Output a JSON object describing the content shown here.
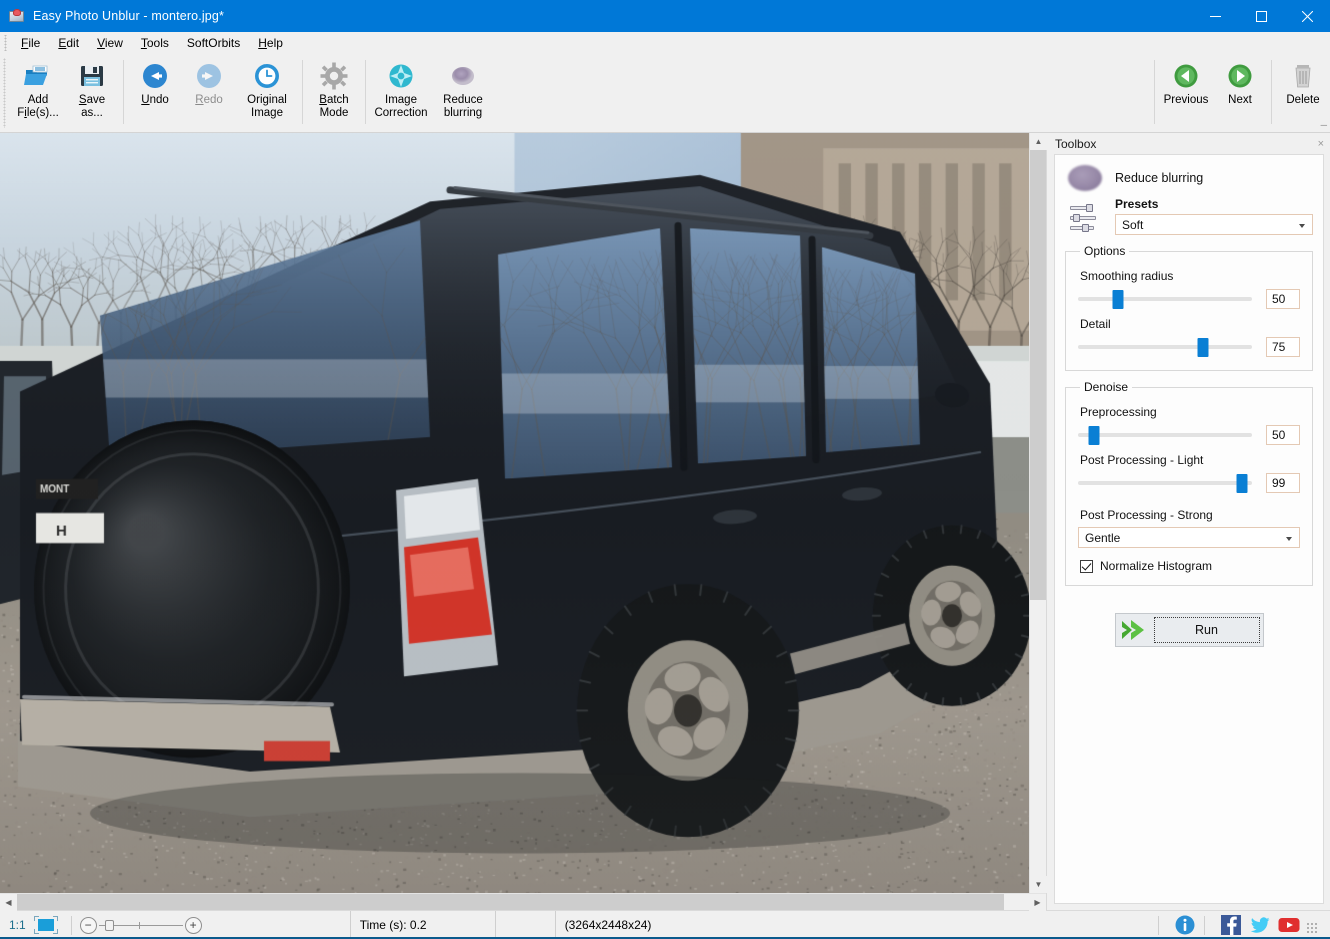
{
  "window": {
    "title": "Easy Photo Unblur - montero.jpg*",
    "app_icon": "photo-app-icon",
    "minimize_label": "Minimize",
    "maximize_label": "Maximize",
    "close_label": "Close",
    "titlebar_color": "#0078d7"
  },
  "menubar": {
    "items": [
      {
        "label": "File",
        "accel": "F"
      },
      {
        "label": "Edit",
        "accel": "E"
      },
      {
        "label": "View",
        "accel": "V"
      },
      {
        "label": "Tools",
        "accel": "T"
      },
      {
        "label": "SoftOrbits",
        "accel": ""
      },
      {
        "label": "Help",
        "accel": "H"
      }
    ]
  },
  "toolbar": {
    "left_buttons": [
      {
        "name": "add-files",
        "label": "Add\nFile(s)...",
        "icon": "open-folder-icon",
        "disabled": false
      },
      {
        "name": "save-as",
        "label": "Save\nas...",
        "icon": "floppy-save-icon",
        "disabled": false
      },
      {
        "name": "undo",
        "label": "Undo",
        "icon": "undo-arrow-icon",
        "disabled": false
      },
      {
        "name": "redo",
        "label": "Redo",
        "icon": "redo-arrow-icon",
        "disabled": true
      },
      {
        "name": "original-image",
        "label": "Original\nImage",
        "icon": "clock-history-icon",
        "disabled": false
      },
      {
        "name": "batch-mode",
        "label": "Batch\nMode",
        "icon": "gear-icon",
        "disabled": false
      },
      {
        "name": "image-correction",
        "label": "Image\nCorrection",
        "icon": "teal-star-icon",
        "disabled": false
      },
      {
        "name": "reduce-blurring",
        "label": "Reduce\nblurring",
        "icon": "purple-blur-icon",
        "disabled": false
      }
    ],
    "right_buttons": [
      {
        "name": "previous",
        "label": "Previous",
        "icon": "green-left-arrow-icon"
      },
      {
        "name": "next",
        "label": "Next",
        "icon": "green-right-arrow-icon"
      },
      {
        "name": "delete",
        "label": "Delete",
        "icon": "trash-can-icon"
      }
    ],
    "expand_glyph": "─"
  },
  "toolbox": {
    "header": "Toolbox",
    "close_glyph": "×",
    "tool_name": "Reduce blurring",
    "tool_icon": "purple-blur-icon",
    "presets": {
      "icon": "sliders-icon",
      "label": "Presets",
      "value": "Soft"
    },
    "options": {
      "legend": "Options",
      "fields": [
        {
          "name": "smoothing-radius",
          "label": "Smoothing radius",
          "value": "50",
          "percent": 23
        },
        {
          "name": "detail",
          "label": "Detail",
          "value": "75",
          "percent": 72
        }
      ]
    },
    "denoise": {
      "legend": "Denoise",
      "fields": [
        {
          "name": "preprocessing",
          "label": "Preprocessing",
          "value": "50",
          "percent": 9
        },
        {
          "name": "post-processing-light",
          "label": "Post Processing - Light",
          "value": "99",
          "percent": 94
        }
      ],
      "strong": {
        "label": "Post Processing - Strong",
        "value": "Gentle"
      },
      "checkbox": {
        "label": "Normalize Histogram",
        "checked": true
      }
    },
    "run": {
      "label": "Run",
      "icon": "green-double-arrow-icon"
    }
  },
  "statusbar": {
    "zoom_ratio": "1:1",
    "fit_icon": "fit-to-screen-icon",
    "zoom_out_glyph": "−",
    "zoom_in_glyph": "+",
    "time": "Time (s): 0.2",
    "blank": "",
    "dimensions": "(3264x2448x24)",
    "social": [
      {
        "name": "info-icon",
        "title": "Info"
      },
      {
        "name": "facebook-icon",
        "title": "Facebook"
      },
      {
        "name": "twitter-icon",
        "title": "Twitter"
      },
      {
        "name": "youtube-icon",
        "title": "YouTube"
      }
    ]
  },
  "canvas": {
    "photo_alt": "Dark Mitsubishi Montero SUV parked on gravel, rear three-quarter view with spare tire cover",
    "scroll": {
      "h_visible": true,
      "v_visible": true
    }
  }
}
